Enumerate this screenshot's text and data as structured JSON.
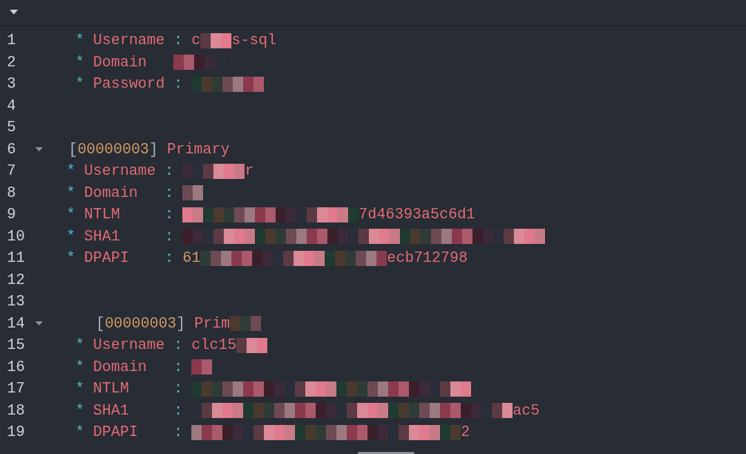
{
  "editor": {
    "lines": [
      {
        "number": "1",
        "foldable": false,
        "tokens": [
          {
            "kind": "star",
            "text": "*"
          },
          {
            "kind": "key",
            "text": "Username"
          },
          {
            "kind": "colon",
            "text": ":"
          },
          {
            "kind": "str",
            "text": "c"
          },
          {
            "kind": "mosaic"
          },
          {
            "kind": "str",
            "text": "s-sql"
          }
        ]
      },
      {
        "number": "2",
        "foldable": false,
        "tokens": [
          {
            "kind": "star",
            "text": "*"
          },
          {
            "kind": "key",
            "text": "Domain"
          },
          {
            "kind": "mosaic"
          }
        ]
      },
      {
        "number": "3",
        "foldable": false,
        "tokens": [
          {
            "kind": "star",
            "text": "*"
          },
          {
            "kind": "key",
            "text": "Password"
          },
          {
            "kind": "colon",
            "text": ":"
          },
          {
            "kind": "mosaic"
          }
        ]
      },
      {
        "number": "4",
        "foldable": false
      },
      {
        "number": "5",
        "foldable": false
      },
      {
        "number": "6",
        "foldable": true,
        "tokens": [
          {
            "kind": "bracket",
            "text": "["
          },
          {
            "kind": "num",
            "text": "00000003"
          },
          {
            "kind": "bracket",
            "text": "]"
          },
          {
            "kind": "str",
            "text": "Primary"
          }
        ]
      },
      {
        "number": "7",
        "foldable": false,
        "tokens": [
          {
            "kind": "star",
            "text": "*"
          },
          {
            "kind": "key",
            "text": "Username"
          },
          {
            "kind": "colon",
            "text": ":"
          },
          {
            "kind": "mosaic"
          },
          {
            "kind": "str",
            "text": "r"
          }
        ]
      },
      {
        "number": "8",
        "foldable": false,
        "tokens": [
          {
            "kind": "star",
            "text": "*"
          },
          {
            "kind": "key",
            "text": "Domain"
          },
          {
            "kind": "colon",
            "text": ":"
          },
          {
            "kind": "mosaic"
          }
        ]
      },
      {
        "number": "9",
        "foldable": false,
        "tokens": [
          {
            "kind": "star",
            "text": "*"
          },
          {
            "kind": "key",
            "text": "NTLM"
          },
          {
            "kind": "colon",
            "text": ":"
          },
          {
            "kind": "mosaic"
          },
          {
            "kind": "str",
            "text": "7d46393a5c6d1"
          }
        ]
      },
      {
        "number": "10",
        "foldable": false,
        "tokens": [
          {
            "kind": "star",
            "text": "*"
          },
          {
            "kind": "key",
            "text": "SHA1"
          },
          {
            "kind": "colon",
            "text": ":"
          },
          {
            "kind": "mosaic"
          }
        ]
      },
      {
        "number": "11",
        "foldable": false,
        "tokens": [
          {
            "kind": "star",
            "text": "*"
          },
          {
            "kind": "key",
            "text": "DPAPI"
          },
          {
            "kind": "colon",
            "text": ":"
          },
          {
            "kind": "num",
            "text": "61"
          },
          {
            "kind": "mosaic"
          },
          {
            "kind": "str",
            "text": "ecb712798"
          }
        ]
      },
      {
        "number": "12",
        "foldable": false
      },
      {
        "number": "13",
        "foldable": false
      },
      {
        "number": "14",
        "foldable": true,
        "tokens": [
          {
            "kind": "bracket",
            "text": "["
          },
          {
            "kind": "num",
            "text": "00000003"
          },
          {
            "kind": "bracket",
            "text": "]"
          },
          {
            "kind": "str",
            "text": "Prim"
          },
          {
            "kind": "mosaic"
          }
        ]
      },
      {
        "number": "15",
        "foldable": false,
        "tokens": [
          {
            "kind": "star",
            "text": "*"
          },
          {
            "kind": "key",
            "text": "Username"
          },
          {
            "kind": "colon",
            "text": ":"
          },
          {
            "kind": "str",
            "text": "clc15"
          },
          {
            "kind": "mosaic"
          }
        ]
      },
      {
        "number": "16",
        "foldable": false,
        "tokens": [
          {
            "kind": "star",
            "text": "*"
          },
          {
            "kind": "key",
            "text": "Domain"
          },
          {
            "kind": "colon",
            "text": ":"
          },
          {
            "kind": "mosaic"
          }
        ]
      },
      {
        "number": "17",
        "foldable": false,
        "tokens": [
          {
            "kind": "star",
            "text": "*"
          },
          {
            "kind": "key",
            "text": "NTLM"
          },
          {
            "kind": "colon",
            "text": ":"
          },
          {
            "kind": "mosaic"
          }
        ]
      },
      {
        "number": "18",
        "foldable": false,
        "tokens": [
          {
            "kind": "star",
            "text": "*"
          },
          {
            "kind": "key",
            "text": "SHA1"
          },
          {
            "kind": "colon",
            "text": ":"
          },
          {
            "kind": "mosaic"
          },
          {
            "kind": "str",
            "text": "ac5"
          }
        ]
      },
      {
        "number": "19",
        "foldable": false,
        "tokens": [
          {
            "kind": "star",
            "text": "*"
          },
          {
            "kind": "key",
            "text": "DPAPI"
          },
          {
            "kind": "colon",
            "text": ":"
          },
          {
            "kind": "mosaic"
          },
          {
            "kind": "str",
            "text": "2"
          }
        ]
      }
    ]
  }
}
